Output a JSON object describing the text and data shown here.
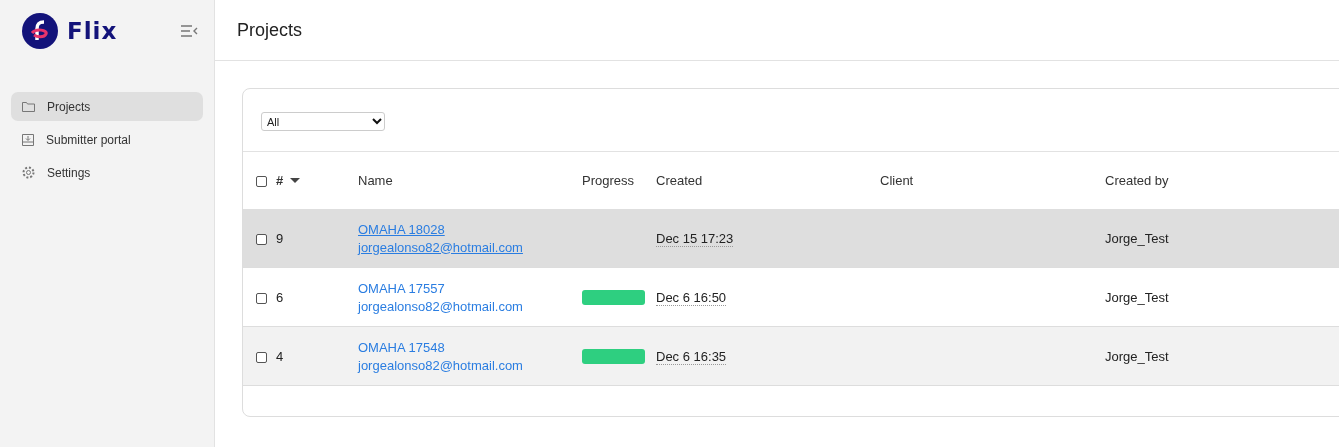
{
  "brand": {
    "name": "Flix"
  },
  "sidebar": {
    "items": [
      {
        "label": "Projects",
        "selected": true
      },
      {
        "label": "Submitter portal",
        "selected": false
      },
      {
        "label": "Settings",
        "selected": false
      }
    ]
  },
  "page": {
    "title": "Projects"
  },
  "filter": {
    "value": "All"
  },
  "table": {
    "all_checked": false,
    "columns": [
      "#",
      "Name",
      "Progress",
      "Created",
      "Client",
      "Created by"
    ],
    "rows": [
      {
        "checked": false,
        "highlighted": true,
        "number": "9",
        "name": "OMAHA 18028",
        "email": "jorgealonso82@hotmail.com",
        "has_progress": false,
        "created": "Dec 15 17:23",
        "created_by": "Jorge_Test"
      },
      {
        "checked": false,
        "highlighted": false,
        "number": "6",
        "name": "OMAHA 17557",
        "email": "jorgealonso82@hotmail.com",
        "has_progress": true,
        "created": "Dec 6 16:50",
        "created_by": "Jorge_Test"
      },
      {
        "checked": false,
        "highlighted": false,
        "number": "4",
        "name": "OMAHA 17548",
        "email": "jorgealonso82@hotmail.com",
        "has_progress": true,
        "created": "Dec 6 16:35",
        "created_by": "Jorge_Test"
      }
    ]
  }
}
